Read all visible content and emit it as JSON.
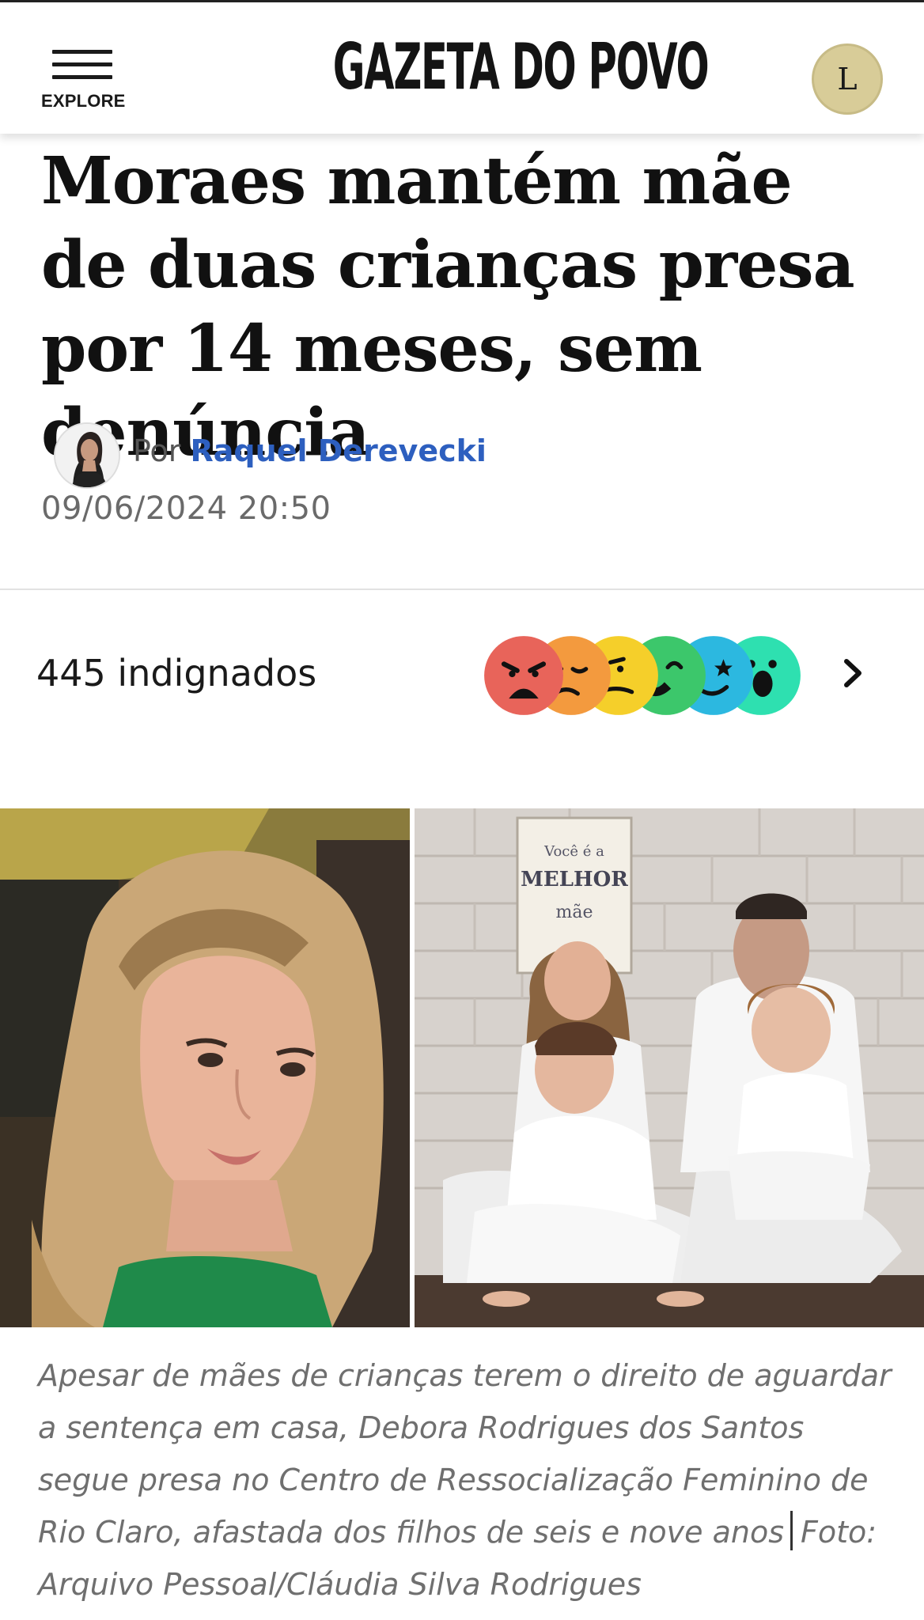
{
  "header": {
    "menu_label": "EXPLORE",
    "logo_text": "GAZETA DO POVO",
    "user_initial": "L"
  },
  "article": {
    "headline": "Moraes mantém mãe de duas crianças presa por 14 meses, sem denúncia",
    "byline_prefix": "Por",
    "author": "Raquel Derevecki",
    "date": "09/06/2024 20:50"
  },
  "reactions": {
    "count_text": "445 indignados",
    "emojis": [
      {
        "icon": "angry-face-icon",
        "color": "#e8645a"
      },
      {
        "icon": "sad-face-icon",
        "color": "#f39a3e"
      },
      {
        "icon": "confused-face-icon",
        "color": "#f5cf2a"
      },
      {
        "icon": "wink-face-icon",
        "color": "#3cc76b"
      },
      {
        "icon": "star-eyes-face-icon",
        "color": "#2cb8e0"
      },
      {
        "icon": "surprised-face-icon",
        "color": "#2ee0b0"
      }
    ]
  },
  "photo": {
    "caption": "Apesar de mães de crianças terem o direito de aguardar a sentença em casa, Debora Rodrigues dos Santos segue presa no Centro de Ressocialização Feminino de Rio Claro, afastada dos filhos de seis e nove anos",
    "credit": "Foto: Arquivo Pessoal/Cláudia Silva Rodrigues",
    "poster_lines": [
      "Você é a",
      "MELHOR",
      "mãe"
    ]
  },
  "colors": {
    "accent_link": "#2d5fbf",
    "avatar_bg": "#d8cc98"
  }
}
